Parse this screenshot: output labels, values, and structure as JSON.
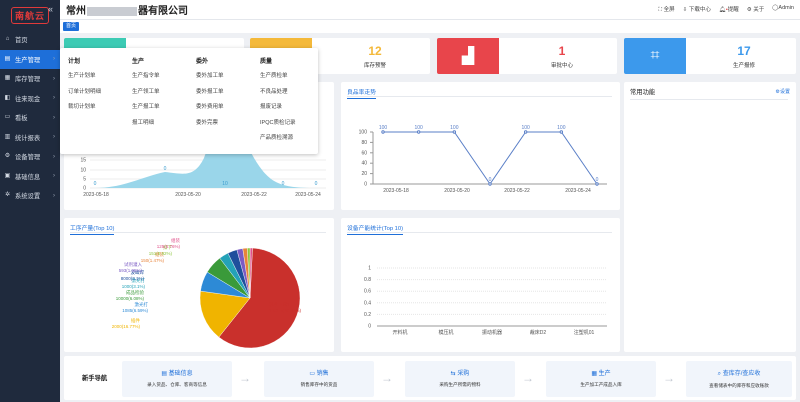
{
  "sidebar": {
    "logo": "南航云",
    "items": [
      {
        "label": "首页",
        "icon": "home-icon",
        "glyph": "⌂"
      },
      {
        "label": "生产管理",
        "icon": "production-icon",
        "glyph": "▤"
      },
      {
        "label": "库存管理",
        "icon": "inventory-icon",
        "glyph": "▦"
      },
      {
        "label": "往来现金",
        "icon": "cash-icon",
        "glyph": "◧"
      },
      {
        "label": "看板",
        "icon": "dashboard-icon",
        "glyph": "▭"
      },
      {
        "label": "统计报表",
        "icon": "report-icon",
        "glyph": "▥"
      },
      {
        "label": "设备管理",
        "icon": "device-icon",
        "glyph": "⚙"
      },
      {
        "label": "基础信息",
        "icon": "basic-info-icon",
        "glyph": "▣"
      },
      {
        "label": "系统设置",
        "icon": "settings-icon",
        "glyph": "✲"
      }
    ]
  },
  "header": {
    "company_prefix": "常州",
    "company_suffix": "器有限公司",
    "actions": [
      "全屏",
      "下载中心",
      "提醒",
      "关于",
      "Admin"
    ]
  },
  "tabs": {
    "home": "首页"
  },
  "stats": [
    {
      "label": "库存预警",
      "value": "12",
      "color": "#f4b93a"
    },
    {
      "label": "审批中心",
      "value": "1",
      "color": "#e8454b"
    },
    {
      "label": "生产报修",
      "value": "17",
      "color": "#3c99ec"
    }
  ],
  "mega_menu": {
    "columns": [
      {
        "title": "计划",
        "items": [
          "生产计划单",
          "订单计划明细",
          "裁切计划单"
        ]
      },
      {
        "title": "生产",
        "items": [
          "生产指令单",
          "生产领工单",
          "生产报工单",
          "报工明细"
        ]
      },
      {
        "title": "委外",
        "items": [
          "委外加工单",
          "委外报工单",
          "委外费用单",
          "委外完票"
        ]
      },
      {
        "title": "质量",
        "items": [
          "生产质检单",
          "不良品处理",
          "报废记录",
          "IPQC质检记录",
          "产品质检溯源"
        ]
      }
    ]
  },
  "panels": {
    "pass_rate_title": "良品率走势",
    "common_title": "常用功能",
    "common_settings": "设置",
    "worker_output_title": "工序产量(Top 10)",
    "equipment_title": "设备产能统计(Top 10)"
  },
  "chart_data": [
    {
      "type": "area",
      "x": [
        "2023-05-18",
        "2023-05-20",
        "2023-05-22",
        "2023-05-24"
      ],
      "data_labels": [
        "0",
        "0",
        "10",
        "0",
        "0"
      ],
      "y_ticks": [
        "15",
        "10",
        "5",
        "0"
      ]
    },
    {
      "type": "line",
      "title": "良品率走势",
      "x": [
        "2023-05-18",
        "2023-05-20",
        "2023-05-22",
        "2023-05-24"
      ],
      "values": [
        100,
        100,
        100,
        0,
        100,
        100,
        0
      ],
      "y_ticks": [
        "100",
        "80",
        "60",
        "40",
        "20",
        "0"
      ],
      "ylim": [
        0,
        100
      ]
    },
    {
      "type": "pie",
      "title": "工序产量(Top 10)",
      "slices": [
        {
          "label": "程序下载1",
          "value": "1001.5(60.87%)",
          "color": "#c9302c",
          "pct": 60.87
        },
        {
          "label": "插件",
          "value": "2000(16.77%)",
          "color": "#f0b400",
          "pct": 16.77
        },
        {
          "label": "激光打",
          "value": "1085(6.59%)",
          "color": "#2d8ad6",
          "pct": 6.59
        },
        {
          "label": "成品检验",
          "value": "10000(6.08%)",
          "color": "#3a9a3a",
          "pct": 6.08
        },
        {
          "label": "激光打",
          "value": "1000(3.1%)",
          "color": "#24a2b8",
          "pct": 3.1
        },
        {
          "label": "波峰焊",
          "value": "8000(3.1%)",
          "color": "#1f4e9c",
          "pct": 3.1
        },
        {
          "label": "试剂灌入",
          "value": "593(1.95%)",
          "color": "#7b5bc4",
          "pct": 1.95
        },
        {
          "label": "组装",
          "value": "150(1.47%)",
          "color": "#e8843b",
          "pct": 1.47
        },
        {
          "label": "扣下",
          "value": "151(0.92%)",
          "color": "#8dc63f",
          "pct": 0.92
        },
        {
          "label": "组装",
          "value": "125(0.76%)",
          "color": "#e04f8a",
          "pct": 0.76
        }
      ]
    },
    {
      "type": "bar",
      "title": "设备产能统计(Top 10)",
      "categories": [
        "开料机",
        "模压机",
        "振动机器",
        "裁床D2",
        "注塑机01"
      ],
      "y_ticks": [
        "1",
        "0.8",
        "0.6",
        "0.4",
        "0.2",
        "0"
      ],
      "values": [
        0,
        0,
        0,
        0,
        0
      ],
      "ylim": [
        0,
        1
      ]
    }
  ],
  "guide": {
    "label": "新手导航",
    "cards": [
      {
        "title": "基础信息",
        "desc": "录入货品、仓库、客商等信息",
        "icon": "document-icon",
        "glyph": "▤"
      },
      {
        "title": "销售",
        "desc": "销售库存中的货品",
        "icon": "sales-icon",
        "glyph": "▭"
      },
      {
        "title": "采购",
        "desc": "采购生产所需的物料",
        "icon": "purchase-icon",
        "glyph": "⇆"
      },
      {
        "title": "生产",
        "desc": "生产加工产成品入库",
        "icon": "factory-icon",
        "glyph": "▦"
      },
      {
        "title": "查库存/查应收",
        "desc": "查看储表中的库存和应收账款",
        "icon": "search-icon",
        "glyph": "⌕"
      }
    ]
  }
}
